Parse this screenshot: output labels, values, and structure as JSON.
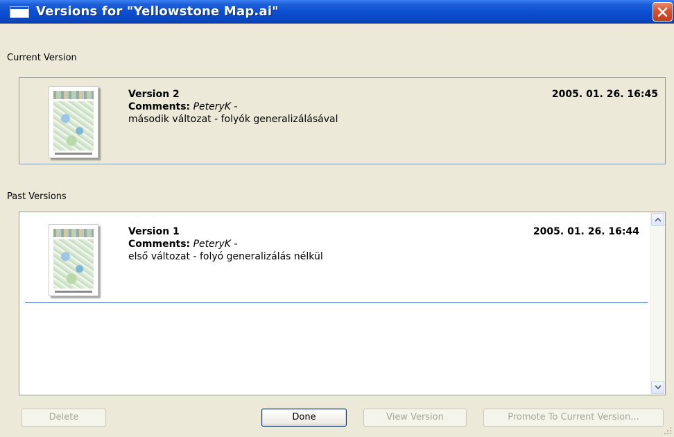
{
  "window": {
    "title": "Versions for \"Yellowstone Map.ai\"",
    "close_label": "×"
  },
  "current_section": {
    "label": "Current Version",
    "version": {
      "title": "Version 2",
      "comments_label": "Comments:",
      "author": "PeteryK",
      "separator": "-",
      "note": "második változat - folyók generalizálásával",
      "date": "2005. 01. 26. 16:45"
    }
  },
  "past_section": {
    "label": "Past Versions",
    "versions": [
      {
        "title": "Version 1",
        "comments_label": "Comments:",
        "author": "PeteryK",
        "separator": "-",
        "note": "első változat - folyó generalizálás nélkül",
        "date": "2005. 01. 26. 16:44"
      }
    ]
  },
  "buttons": {
    "delete": "Delete",
    "done": "Done",
    "view_version": "View Version",
    "promote": "Promote To Current Version..."
  },
  "colors": {
    "titlebar": "#0b4fd1",
    "dialog_bg": "#ece9d8",
    "panel_border": "#7f9db9",
    "close_button": "#d6512e"
  },
  "icons": {
    "window": "window-icon",
    "close": "close-icon",
    "scroll_up": "chevron-up-icon",
    "scroll_down": "chevron-down-icon",
    "resize": "resize-grip-icon"
  }
}
